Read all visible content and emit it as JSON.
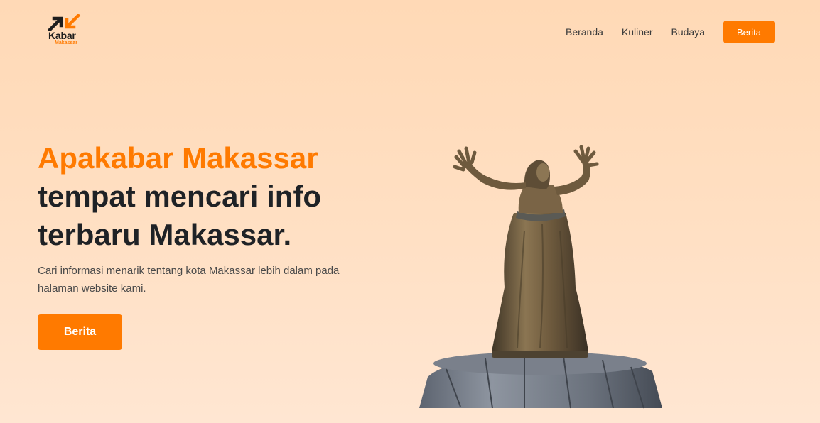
{
  "brand": {
    "name": "Kabar",
    "sub": "Makassar",
    "accent_color": "#ff7a00",
    "dark_color": "#1e1e1e"
  },
  "nav": {
    "links": [
      "Beranda",
      "Kuliner",
      "Budaya"
    ],
    "button_label": "Berita"
  },
  "hero": {
    "title_accent": "Apakabar Makassar",
    "title_line_1": "tempat mencari info",
    "title_line_2": "terbaru Makassar.",
    "description": "Cari informasi menarik tentang kota Makassar lebih dalam pada halaman website kami.",
    "button_label": "Berita",
    "image_icon": "statue-image"
  }
}
